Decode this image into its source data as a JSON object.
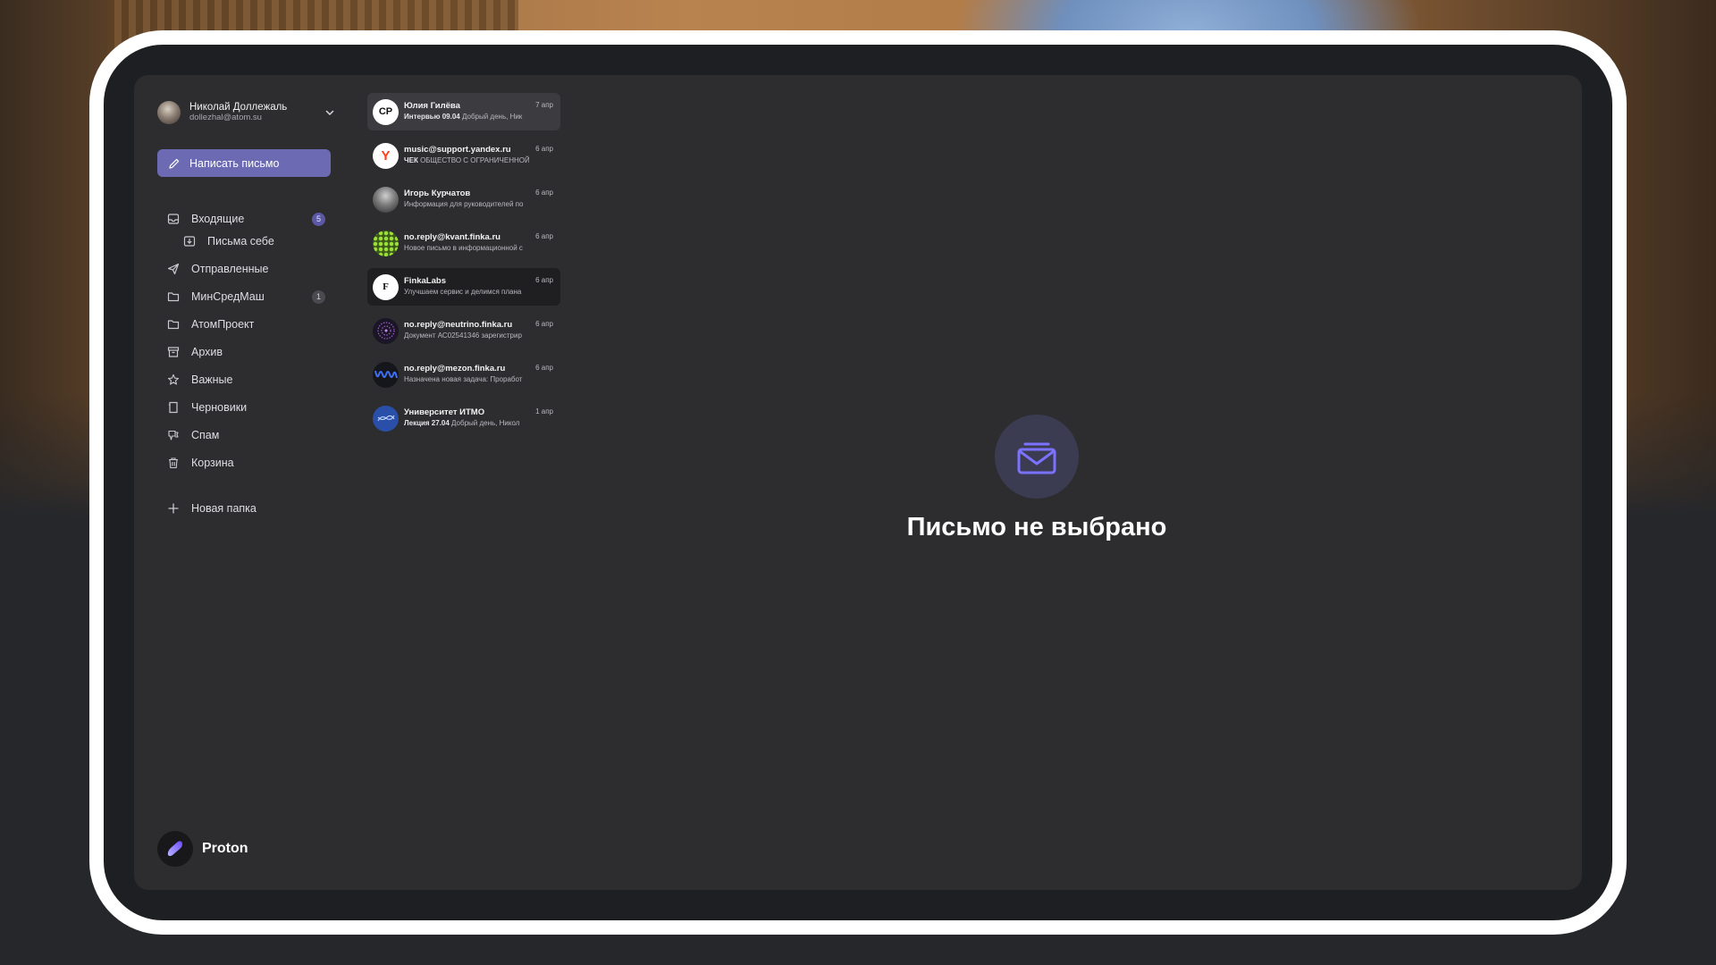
{
  "account": {
    "name": "Николай Доллежаль",
    "email": "dollezhal@atom.su"
  },
  "compose_label": "Написать письмо",
  "nav": [
    {
      "label": "Входящие",
      "icon": "inbox-icon",
      "badge": "5",
      "badge_style": "accent"
    },
    {
      "label": "Письма себе",
      "icon": "self-mail-icon",
      "sub": true
    },
    {
      "label": "Отправленные",
      "icon": "send-icon"
    },
    {
      "label": "МинСредМаш",
      "icon": "folder-icon",
      "badge": "1",
      "badge_style": "muted"
    },
    {
      "label": "АтомПроект",
      "icon": "folder-icon"
    },
    {
      "label": "Архив",
      "icon": "archive-icon"
    },
    {
      "label": "Важные",
      "icon": "star-icon"
    },
    {
      "label": "Черновики",
      "icon": "draft-icon"
    },
    {
      "label": "Спам",
      "icon": "spam-icon"
    },
    {
      "label": "Корзина",
      "icon": "trash-icon"
    },
    {
      "label": "Новая папка",
      "icon": "plus-icon"
    }
  ],
  "brand": {
    "name": "Proton"
  },
  "mails": [
    {
      "from": "Юлия Гилёва",
      "subject": "Интервью 09.04",
      "preview": "Добрый день, Ник",
      "date": "7 апр",
      "avatar": "cp-logo-icon",
      "avatar_text": "CP",
      "state": "hover"
    },
    {
      "from": "music@support.yandex.ru",
      "subject": "ЧЕК",
      "preview": "ОБЩЕСТВО С ОГРАНИЧЕННОЙ",
      "date": "6 апр",
      "avatar": "yandex-logo-icon",
      "avatar_text": "Y"
    },
    {
      "from": "Игорь Курчатов",
      "subject": "",
      "preview": "Информация для руководителей по",
      "date": "6 апр",
      "avatar": "person-photo-icon",
      "avatar_text": ""
    },
    {
      "from": "no.reply@kvant.finka.ru",
      "subject": "",
      "preview": "Новое письмо в информационной с",
      "date": "6 апр",
      "avatar": "kvant-logo-icon",
      "avatar_text": ""
    },
    {
      "from": "FinkaLabs",
      "subject": "",
      "preview": "Улучшаем сервис и делимся плана",
      "date": "6 апр",
      "avatar": "finkalabs-logo-icon",
      "avatar_text": "F",
      "state": "active"
    },
    {
      "from": "no.reply@neutrino.finka.ru",
      "subject": "",
      "preview": "Документ АС02541346 зарегистрир",
      "date": "6 апр",
      "avatar": "neutrino-logo-icon",
      "avatar_text": ""
    },
    {
      "from": "no.reply@mezon.finka.ru",
      "subject": "",
      "preview": "Назначена новая задача: Проработ",
      "date": "6 апр",
      "avatar": "mezon-logo-icon",
      "avatar_text": ""
    },
    {
      "from": "Университет ИТМО",
      "subject": "Лекция 27.04",
      "preview": "Добрый день, Никол",
      "date": "1 апр",
      "avatar": "itmo-logo-icon",
      "avatar_text": ""
    }
  ],
  "empty_state": {
    "icon": "envelope-icon",
    "text": "Письмо не выбрано"
  },
  "colors": {
    "accent": "#6c6ab3",
    "panel": "#2d2d2f",
    "frame": "#ffffff"
  }
}
